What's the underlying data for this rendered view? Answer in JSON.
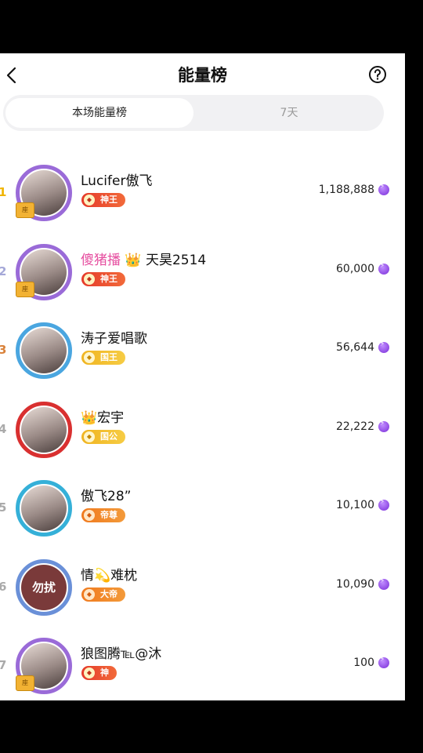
{
  "header": {
    "title": "能量榜"
  },
  "tabs": [
    {
      "label": "本场能量榜",
      "active": true
    },
    {
      "label": "7天",
      "active": false
    }
  ],
  "rows": [
    {
      "rank": "1",
      "rank_color": "#f0b400",
      "name": "Lucifer傲飞",
      "badge": "神王",
      "badge_style": "red",
      "score": "1,188,888",
      "ring": "#9a6bd8",
      "tag": "座"
    },
    {
      "rank": "2",
      "rank_color": "#a5a8d8",
      "name_pink": "傻猪播",
      "name_rest": "天昊2514",
      "badge": "神王",
      "badge_style": "red",
      "score": "60,000",
      "ring": "#9a6bd8",
      "tag": "座"
    },
    {
      "rank": "3",
      "rank_color": "#d9823a",
      "name": "涛子爱唱歌",
      "badge": "国王",
      "badge_style": "gold",
      "score": "56,644",
      "ring": "#4aa6e0"
    },
    {
      "rank": "4",
      "rank_color": "#aaaaaa",
      "name": "宏宇",
      "name_prefix": "👑",
      "badge": "国公",
      "badge_style": "gold",
      "score": "22,222",
      "ring": "#d93030"
    },
    {
      "rank": "5",
      "rank_color": "#aaaaaa",
      "name": "傲飞28”",
      "badge": "帝尊",
      "badge_style": "orange",
      "score": "10,100",
      "ring": "#35b0d8"
    },
    {
      "rank": "6",
      "rank_color": "#aaaaaa",
      "name": "情💫难枕",
      "badge": "大帝",
      "badge_style": "orange",
      "score": "10,090",
      "ring": "#6a90d8",
      "avatar_text": "勿扰"
    },
    {
      "rank": "7",
      "rank_color": "#aaaaaa",
      "name": "狼图腾℡@沐",
      "badge": "神",
      "badge_style": "red",
      "score": "100",
      "ring": "#9a6bd8",
      "tag": "座"
    }
  ]
}
